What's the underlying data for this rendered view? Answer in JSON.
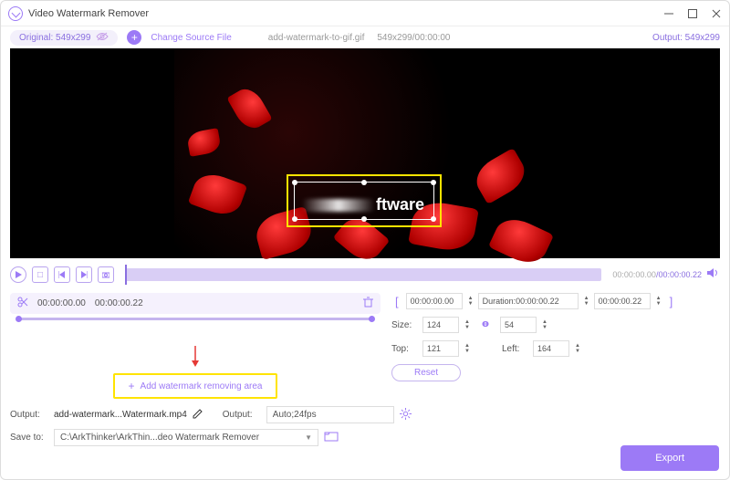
{
  "titlebar": {
    "title": "Video Watermark Remover"
  },
  "infobar": {
    "original_label": "Original: 549x299",
    "change_source": "Change Source File",
    "filename": "add-watermark-to-gif.gif",
    "file_meta": "549x299/00:00:00",
    "output_label": "Output: 549x299"
  },
  "watermark_overlay": {
    "text": "ftware"
  },
  "playback": {
    "time_elapsed": "00:00:00.00",
    "time_total": "00:00:00.22"
  },
  "segment": {
    "start": "00:00:00.00",
    "end": "00:00:00.22"
  },
  "range_controls": {
    "start": "00:00:00.00",
    "duration_label": "Duration:00:00:00.22",
    "end": "00:00:00.22",
    "size_label": "Size:",
    "width": "124",
    "height": "54",
    "top_label": "Top:",
    "top": "121",
    "left_label": "Left:",
    "left": "164",
    "reset": "Reset"
  },
  "add_area": {
    "label": "Add watermark removing area"
  },
  "output": {
    "label": "Output:",
    "filename": "add-watermark...Watermark.mp4",
    "format_label": "Output:",
    "format_value": "Auto;24fps"
  },
  "saveto": {
    "label": "Save to:",
    "path": "C:\\ArkThinker\\ArkThin...deo Watermark Remover"
  },
  "export": {
    "label": "Export"
  }
}
